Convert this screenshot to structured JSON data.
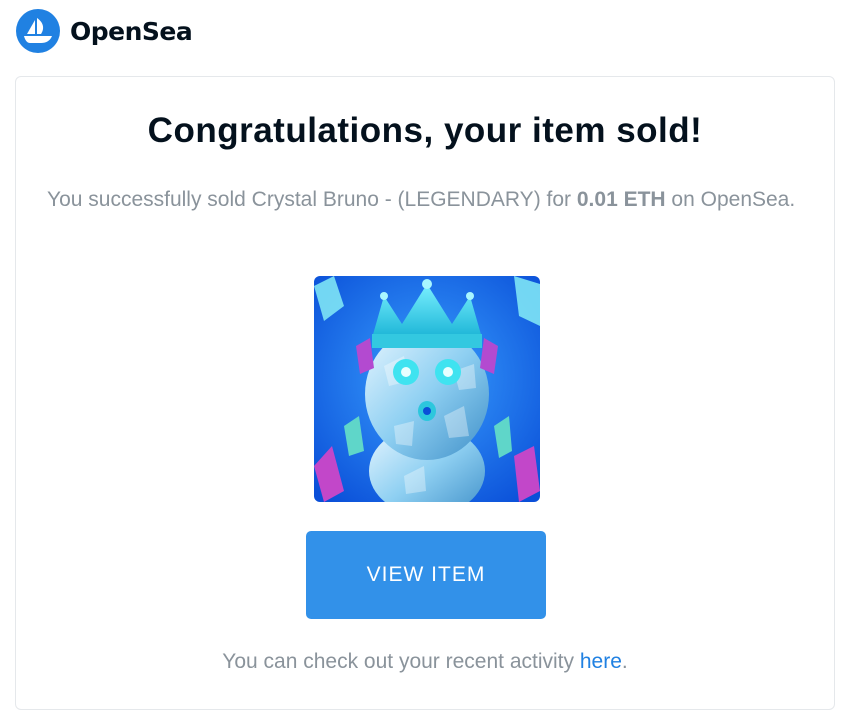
{
  "header": {
    "logo_icon": "opensea-ship-icon",
    "brand": "OpenSea"
  },
  "card": {
    "title": "Congratulations, your item sold!",
    "message": {
      "prefix": "You successfully sold Crystal Bruno - (LEGENDARY) for ",
      "price": "0.01 ETH",
      "suffix": " on OpenSea."
    },
    "image_alt": "Crystal Bruno NFT artwork",
    "button_label": "VIEW ITEM",
    "footer": {
      "prefix": "You can check out your recent activity ",
      "link": "here",
      "suffix": "."
    }
  },
  "colors": {
    "brand_blue": "#2081e2",
    "button_blue": "#3291e9",
    "text_dark": "#04111d",
    "text_muted": "#8a939b"
  }
}
